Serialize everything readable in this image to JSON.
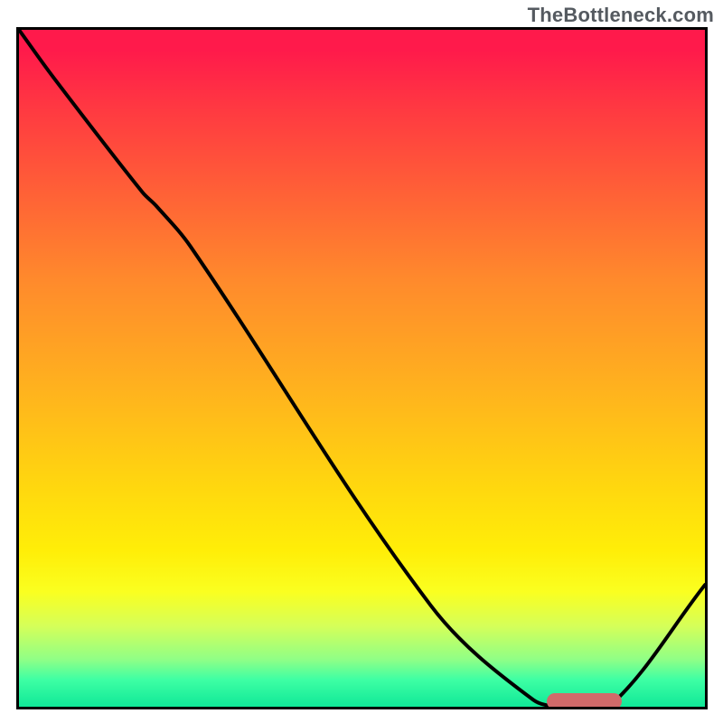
{
  "watermark": "TheBottleneck.com",
  "chart_data": {
    "type": "line",
    "title": "",
    "xlabel": "",
    "ylabel": "",
    "xlim": [
      0,
      1
    ],
    "ylim": [
      0,
      1
    ],
    "x": [
      0.0,
      0.05,
      0.18,
      0.2,
      0.25,
      0.6,
      0.75,
      0.8,
      0.86,
      1.0
    ],
    "values": [
      1.0,
      0.93,
      0.76,
      0.74,
      0.68,
      0.15,
      0.01,
      0.0,
      0.0,
      0.18
    ],
    "marker": {
      "x_start": 0.77,
      "x_end": 0.88,
      "y": 0.005
    },
    "gradient_stops": [
      {
        "pos": 0.0,
        "color": "#ff1a4b"
      },
      {
        "pos": 0.12,
        "color": "#ff3a41"
      },
      {
        "pos": 0.27,
        "color": "#ff6a34"
      },
      {
        "pos": 0.37,
        "color": "#ff8a2c"
      },
      {
        "pos": 0.53,
        "color": "#ffb21e"
      },
      {
        "pos": 0.67,
        "color": "#ffd60f"
      },
      {
        "pos": 0.77,
        "color": "#ffee08"
      },
      {
        "pos": 0.83,
        "color": "#faff20"
      },
      {
        "pos": 0.88,
        "color": "#d6ff58"
      },
      {
        "pos": 0.93,
        "color": "#90ff86"
      },
      {
        "pos": 0.96,
        "color": "#3effa4"
      },
      {
        "pos": 1.0,
        "color": "#10e898"
      }
    ]
  }
}
